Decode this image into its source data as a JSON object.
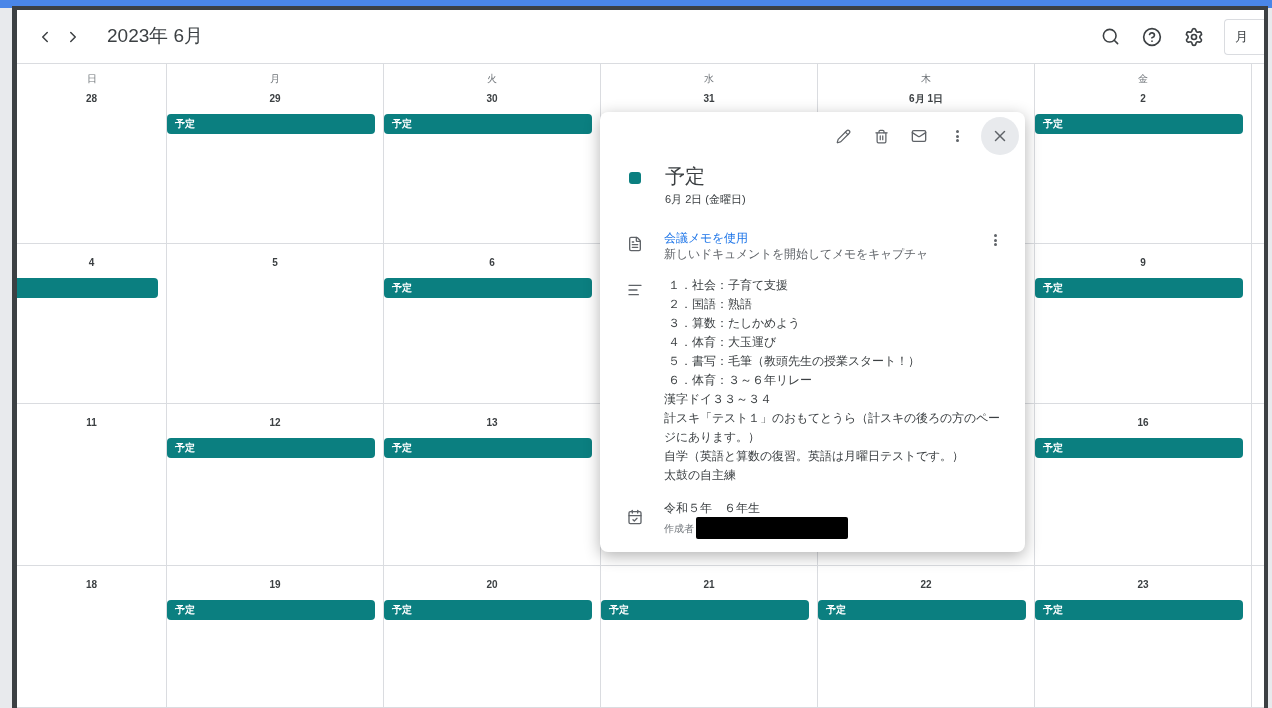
{
  "header": {
    "title": "2023年 6月",
    "view_button": "月"
  },
  "weekdays": [
    "日",
    "月",
    "火",
    "水",
    "木",
    "金"
  ],
  "weeks": [
    {
      "days": [
        {
          "kind": "day",
          "date": "28"
        },
        {
          "kind": "day",
          "date": "29",
          "event": {
            "kind": "labeled",
            "label": "予定"
          }
        },
        {
          "kind": "day",
          "date": "30",
          "event": {
            "kind": "labeled",
            "label": "予定"
          }
        },
        {
          "kind": "day",
          "date": "31"
        },
        {
          "kind": "day",
          "date": "6月 1日"
        },
        {
          "kind": "day",
          "date": "2",
          "event": {
            "kind": "labeled",
            "label": "予定"
          }
        }
      ]
    },
    {
      "days": [
        {
          "kind": "day",
          "date": "4",
          "event": {
            "kind": "continuation"
          }
        },
        {
          "kind": "day",
          "date": "5"
        },
        {
          "kind": "day",
          "date": "6",
          "event": {
            "kind": "labeled",
            "label": "予定"
          }
        },
        {
          "kind": "covered"
        },
        {
          "kind": "covered"
        },
        {
          "kind": "day",
          "date": "9",
          "event": {
            "kind": "labeled",
            "label": "予定"
          }
        }
      ]
    },
    {
      "days": [
        {
          "kind": "day",
          "date": "11"
        },
        {
          "kind": "day",
          "date": "12",
          "event": {
            "kind": "labeled",
            "label": "予定"
          }
        },
        {
          "kind": "day",
          "date": "13",
          "event": {
            "kind": "labeled",
            "label": "予定"
          }
        },
        {
          "kind": "blank"
        },
        {
          "kind": "blank"
        },
        {
          "kind": "day",
          "date": "16",
          "event": {
            "kind": "labeled",
            "label": "予定"
          }
        }
      ]
    },
    {
      "days": [
        {
          "kind": "day",
          "date": "18"
        },
        {
          "kind": "day",
          "date": "19",
          "event": {
            "kind": "labeled",
            "label": "予定"
          }
        },
        {
          "kind": "day",
          "date": "20",
          "event": {
            "kind": "labeled",
            "label": "予定"
          }
        },
        {
          "kind": "day",
          "date": "21",
          "event": {
            "kind": "labeled",
            "label": "予定"
          }
        },
        {
          "kind": "day",
          "date": "22",
          "event": {
            "kind": "labeled",
            "label": "予定"
          }
        },
        {
          "kind": "day",
          "date": "23",
          "event": {
            "kind": "labeled",
            "label": "予定"
          }
        }
      ]
    }
  ],
  "popup": {
    "title": "予定",
    "color": "#0b7f80",
    "date": "6月 2日 (金曜日)",
    "notes": {
      "link": "会議メモを使用",
      "subtitle": "新しいドキュメントを開始してメモをキャプチャ"
    },
    "description": [
      {
        "text": "１．社会：子育て支援",
        "indented": true
      },
      {
        "text": "２．国語：熟語",
        "indented": true
      },
      {
        "text": "３．算数：たしかめよう",
        "indented": true
      },
      {
        "text": "４．体育：大玉運び",
        "indented": true
      },
      {
        "text": "５．書写：毛筆（教頭先生の授業スタート！）",
        "indented": true
      },
      {
        "text": "６．体育：３～６年リレー",
        "indented": true
      },
      {
        "text": "漢字ドイ３３～３４",
        "indented": false
      },
      {
        "text": "計スキ「テスト１」のおもてとうら（計スキの後ろの方のページにあります。）",
        "indented": false
      },
      {
        "text": "自学（英語と算数の復習。英語は月曜日テストです。）",
        "indented": false
      },
      {
        "text": "太鼓の自主練",
        "indented": false
      }
    ],
    "calendar": {
      "name": "令和５年　６年生",
      "creator_label": "作成者"
    }
  }
}
